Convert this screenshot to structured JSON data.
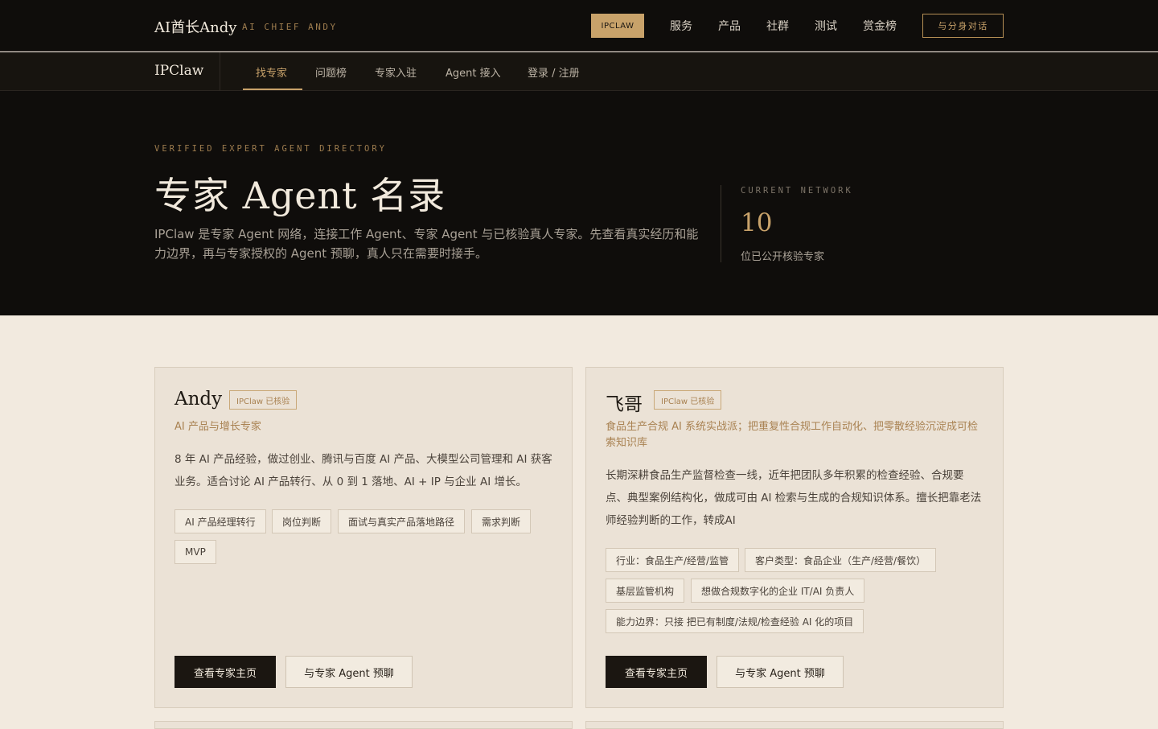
{
  "header": {
    "brand": "AI酋长Andy",
    "brand_sub": "AI CHIEF ANDY",
    "pill": "IPCLAW",
    "links": [
      "服务",
      "产品",
      "社群",
      "测试",
      "赏金榜"
    ],
    "cta": "与分身对话"
  },
  "subnav": {
    "brand": "IPClaw",
    "links": [
      "找专家",
      "问题榜",
      "专家入驻",
      "Agent 接入",
      "登录 / 注册"
    ],
    "active": "找专家"
  },
  "hero": {
    "eyebrow": "VERIFIED EXPERT AGENT DIRECTORY",
    "title": "专家 Agent 名录",
    "description": "IPClaw 是专家 Agent 网络，连接工作 Agent、专家 Agent 与已核验真人专家。先查看真实经历和能力边界，再与专家授权的 Agent 预聊，真人只在需要时接手。",
    "stat_label": "CURRENT NETWORK",
    "stat_value": "10",
    "stat_sub": "位已公开核验专家"
  },
  "cards": [
    {
      "name": "Andy",
      "badge": "IPClaw 已核验",
      "role": "AI 产品与增长专家",
      "bio": "8 年 AI 产品经验，做过创业、腾讯与百度 AI 产品、大模型公司管理和 AI 获客业务。适合讨论 AI 产品转行、从 0 到 1 落地、AI + IP 与企业 AI 增长。",
      "tags": [
        "AI 产品经理转行",
        "岗位判断",
        "面试与真实产品落地路径",
        "需求判断",
        "MVP"
      ],
      "primary": "查看专家主页",
      "secondary": "与专家 Agent 预聊"
    },
    {
      "name": "飞哥",
      "badge": "IPClaw 已核验",
      "role": "食品生产合规 AI 系统实战派；把重复性合规工作自动化、把零散经验沉淀成可检索知识库",
      "bio": "长期深耕食品生产监督检查一线，近年把团队多年积累的检查经验、合规要点、典型案例结构化，做成可由 AI 检索与生成的合规知识体系。擅长把靠老法师经验判断的工作，转成AI",
      "tags": [
        "行业：食品生产/经营/监管",
        "客户类型：食品企业（生产/经营/餐饮）",
        "基层监管机构",
        "想做合规数字化的企业 IT/AI 负责人",
        "能力边界：只接 把已有制度/法规/检查经验 AI 化的项目"
      ],
      "primary": "查看专家主页",
      "secondary": "与专家 Agent 预聊"
    }
  ]
}
